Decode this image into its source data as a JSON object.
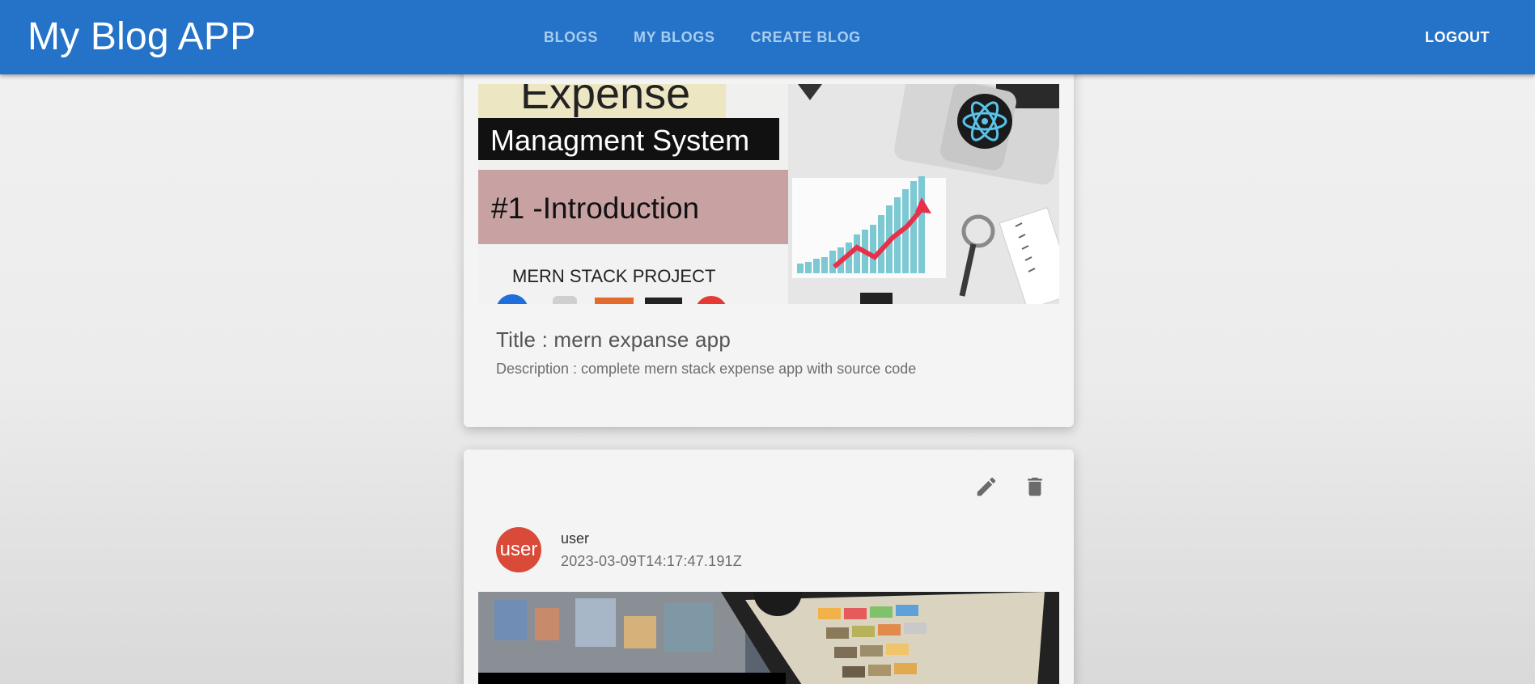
{
  "app": {
    "title": "My Blog APP"
  },
  "nav": {
    "tabs": [
      {
        "label": "BLOGS"
      },
      {
        "label": "MY BLOGS"
      },
      {
        "label": "CREATE BLOG"
      }
    ],
    "logout_label": "LOGOUT"
  },
  "colors": {
    "appbar": "#2473c8",
    "avatar": "#d94a38"
  },
  "blogs": [
    {
      "thumbnail": {
        "line1": "Expense",
        "line2": "Managment System",
        "line3": "#1 -Introduction",
        "line4": "MERN STACK PROJECT"
      },
      "title": "Title : mern expanse app",
      "description": "Description : complete mern stack expense app with source code"
    },
    {
      "actions": {
        "edit_icon": "edit-icon",
        "delete_icon": "delete-icon"
      },
      "avatar_text": "user",
      "author": "user",
      "date": "2023-03-09T14:17:47.191Z"
    }
  ]
}
